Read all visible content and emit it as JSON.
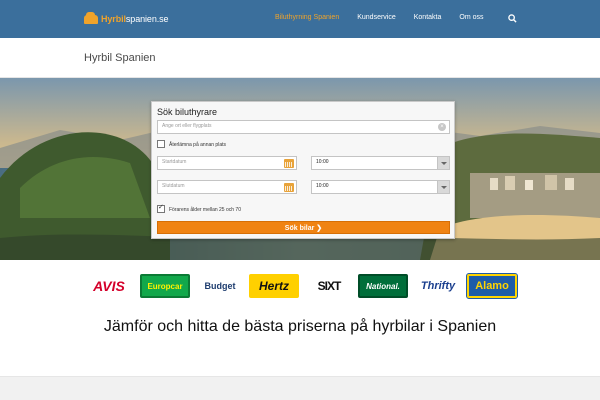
{
  "header": {
    "logo_main": "Hyrbil",
    "logo_domain": "spanien.se",
    "nav": [
      {
        "label": "Biluthyrning Spanien",
        "active": true
      },
      {
        "label": "Kundservice",
        "active": false
      },
      {
        "label": "Kontakta",
        "active": false
      },
      {
        "label": "Om oss",
        "active": false
      }
    ],
    "search_icon": "search-icon",
    "colors": {
      "bar": "#3b6f9c",
      "accent": "#f0a32a"
    }
  },
  "page": {
    "title": "Hyrbil Spanien"
  },
  "search_form": {
    "title": "Sök biluthyrare",
    "location_placeholder": "Ange ort eller flygplats",
    "return_other_label": "Återlämna på annan plats",
    "return_other_checked": false,
    "start_date_placeholder": "Startdatum",
    "start_time": "10:00",
    "end_date_placeholder": "Slutdatum",
    "end_time": "10:00",
    "driver_age_label": "Förarens ålder mellan 25 och 70",
    "driver_age_checked": true,
    "submit_label": "Sök bilar ❯",
    "button_color": "#f08312"
  },
  "brands": [
    "AVIS",
    "Europcar",
    "Budget",
    "Hertz",
    "SIXT",
    "National.",
    "Thrifty",
    "Alamo"
  ],
  "headline": "Jämför och hitta de bästa priserna på hyrbilar i Spanien"
}
